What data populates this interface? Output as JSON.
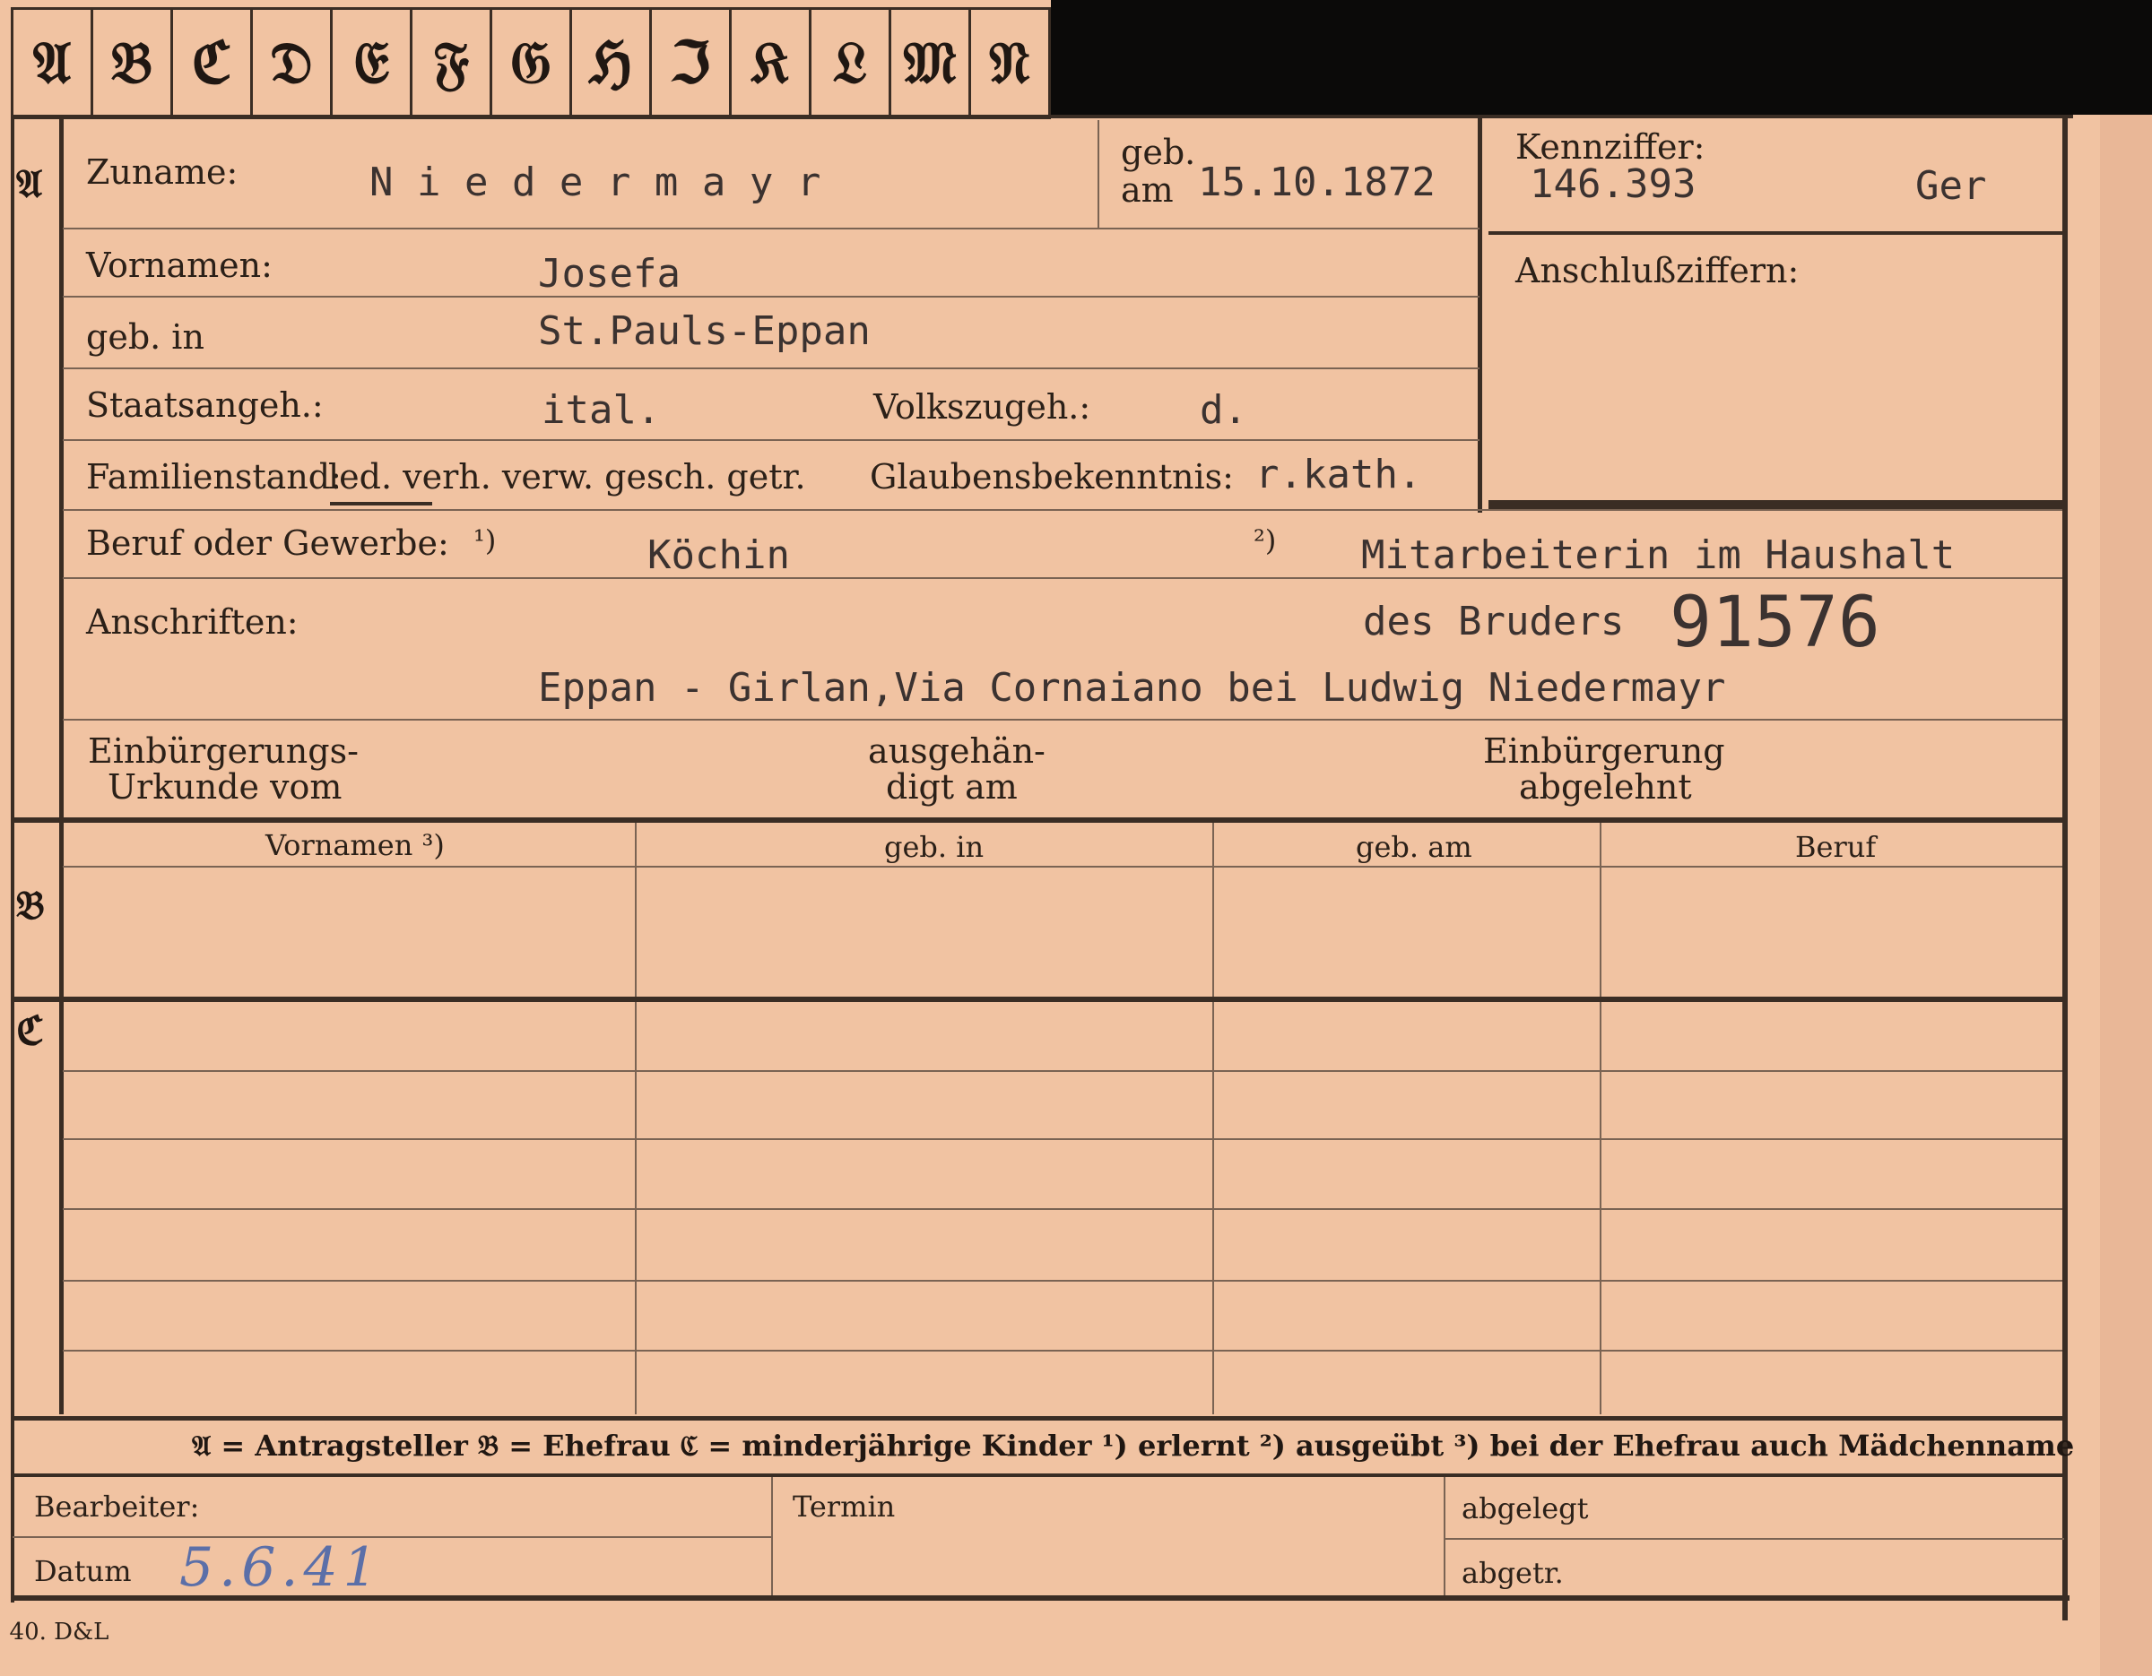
{
  "tabs": [
    "𝔄",
    "𝔅",
    "ℭ",
    "𝔇",
    "𝔈",
    "𝔉",
    "𝔊",
    "ℌ",
    "ℑ",
    "𝔎",
    "𝔏",
    "𝔐",
    "𝔑"
  ],
  "sections": {
    "a": "𝔄",
    "b": "𝔅",
    "c": "ℭ"
  },
  "labels": {
    "zuname": "Zuname:",
    "geb_am_top": "geb.",
    "geb_am_bottom": "am",
    "kennziffer": "Kennziffer:",
    "vornamen": "Vornamen:",
    "anschlussziffern": "Anschlußziffern:",
    "geb_in": "geb. in",
    "staatsangeh": "Staatsangeh.:",
    "volkszugeh": "Volkszugeh.:",
    "familienstand_prefix": "Familienstand:",
    "familienstand_options": "led. verh. verw. gesch. getr.",
    "glaubensbekenntnis": "Glaubensbekenntnis:",
    "beruf": "Beruf oder Gewerbe:",
    "beruf_note1": "¹)",
    "beruf_note2": "²)",
    "anschriften": "Anschriften:",
    "einburgerung_urkunde_1": "Einbürgerungs-",
    "einburgerung_urkunde_2": "Urkunde vom",
    "ausgehaendigt_1": "ausgehän-",
    "ausgehaendigt_2": "digt am",
    "einbuergerung_abgelehnt_1": "Einbürgerung",
    "einbuergerung_abgelehnt_2": "abgelehnt"
  },
  "values": {
    "zuname": "N i e d e r m a y r",
    "geb_am": "15.10.1872",
    "kennziffer": "146.393",
    "kennziffer_suffix": "Ger",
    "vornamen": "Josefa",
    "geb_in": "St.Pauls-Eppan",
    "staatsangeh": "ital.",
    "volkszugeh": "d.",
    "glaubensbekenntnis": "r.kath.",
    "beruf_erlernt": "Köchin",
    "beruf_ausgeuebt": "Mitarbeiterin im Haushalt",
    "anschrift_line1": "des Bruders",
    "stamp_number": "91576",
    "anschrift_line2": "Eppan - Girlan,Via Cornaiano bei Ludwig Niedermayr"
  },
  "table_headers": [
    "Vornamen ³)",
    "geb. in",
    "geb. am",
    "Beruf"
  ],
  "legend": "𝔄 = Antragsteller   𝔅 = Ehefrau   ℭ = minderjährige Kinder   ¹) erlernt   ²) ausgeübt   ³) bei der Ehefrau auch Mädchenname",
  "footer": {
    "bearbeiter": "Bearbeiter:",
    "datum": "Datum",
    "datum_value": "5.6.41",
    "termin": "Termin",
    "abgelegt": "abgelegt",
    "abgetr": "abgetr."
  },
  "print_mark": ". 40. D&L",
  "colors": {
    "paper": "#f1c3a2",
    "ink": "#2a2018",
    "typewriter": "#3b3230",
    "pencil": "#5b6fa8"
  }
}
